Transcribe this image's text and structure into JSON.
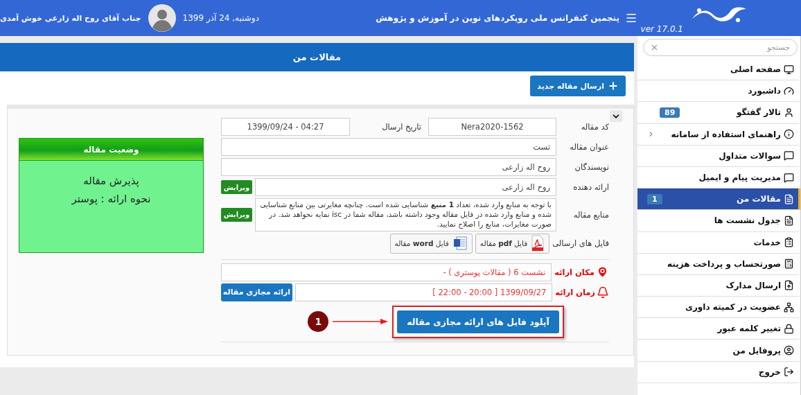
{
  "header": {
    "version": "ver 17.0.1",
    "title": "پنجمین کنفرانس ملی رویکردهای نوین در آموزش و پژوهش",
    "date": "دوشنبه, 24 آذر 1399",
    "welcome": "جناب آقای روح اله زارعی خوش آمدی"
  },
  "sidebar": {
    "search": {
      "placeholder": "جستجو"
    },
    "items": [
      {
        "label": "صفحه اصلی",
        "selected": false,
        "has_submenu": false
      },
      {
        "label": "داشبورد",
        "selected": false,
        "has_submenu": false
      },
      {
        "label": "تالار گفتگو",
        "badge": "89",
        "selected": false,
        "has_submenu": false
      },
      {
        "label": "راهنمای استفاده از سامانه",
        "selected": false,
        "has_submenu": true
      },
      {
        "label": "سوالات متداول",
        "selected": false,
        "has_submenu": false
      },
      {
        "label": "مدیریت پیام و ایمیل",
        "selected": false,
        "has_submenu": false
      },
      {
        "label": "مقالات من",
        "badge": "1",
        "selected": true,
        "has_submenu": false
      },
      {
        "label": "جدول نشست ها",
        "selected": false,
        "has_submenu": false
      },
      {
        "label": "خدمات",
        "selected": false,
        "has_submenu": false
      },
      {
        "label": "صورتحساب و پرداخت هزینه",
        "selected": false,
        "has_submenu": false
      },
      {
        "label": "ارسال مدارک",
        "selected": false,
        "has_submenu": false
      },
      {
        "label": "عضویت در کمیته داوری",
        "selected": false,
        "has_submenu": false
      },
      {
        "label": "تغییر کلمه عبور",
        "selected": false,
        "has_submenu": false
      },
      {
        "label": "پروفایل من",
        "selected": false,
        "has_submenu": false
      },
      {
        "label": "خروج",
        "selected": false,
        "has_submenu": false
      }
    ]
  },
  "main": {
    "title": "مقالات من",
    "new_button": "ارسال مقاله جدید",
    "article": {
      "expanded": true,
      "code": {
        "label": "کد مقاله",
        "value": "Nera2020-1562"
      },
      "date": {
        "label": "تاریخ ارسال",
        "value": "1399/09/24 - 04:27"
      },
      "title_field": {
        "label": "عنوان مقاله",
        "value": "تست"
      },
      "authors": {
        "label": "نویسندگان",
        "value": "روح اله زارعی"
      },
      "presenter": {
        "label": "ارائه دهنده",
        "value": "روح اله زارعی",
        "edit": "ویرایش"
      },
      "sources": {
        "label": "منابع مقاله",
        "text": "با توجه به منابع وارد شده، تعداد **1 منبع** شناسایی شده است. چنانچه مغایرتی بین منابع شناسایی شده و منابع وارد شده در فایل مقاله وجود داشته باشد، مقاله شما در isc نمایه نخواهد شد. در صورت مغایرات، منابع را اصلاح نمایید.",
        "edit": "ویرایش"
      },
      "files": {
        "label": "فایل های ارسالی",
        "items": [
          {
            "kind": "pdf",
            "label": "فایل **pdf** مقاله"
          },
          {
            "kind": "word",
            "label": "فایل **word** مقاله"
          }
        ]
      },
      "place": {
        "label": "مکان ارائه",
        "value": "نشست 6 ( مقالات پوستری ) -"
      },
      "time": {
        "label": "زمان ارائه",
        "value": "1399/09/27 [ 20:00 - 22:00 ]",
        "button": "ارائه مجازی مقاله"
      },
      "upload_button": "آپلود فایل های ارائه مجازی مقاله",
      "annotation": "1"
    },
    "status": {
      "title": "وضعیت مقاله",
      "lines": [
        "پذیرش مقاله",
        "نحوه ارائه : پوستر"
      ]
    }
  }
}
